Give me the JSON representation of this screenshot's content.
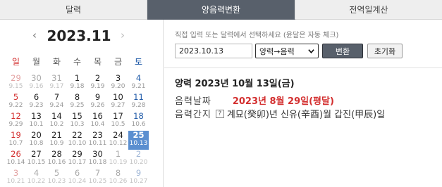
{
  "tabs": [
    {
      "label": "달력"
    },
    {
      "label": "양음력변환"
    },
    {
      "label": "전역일계산"
    }
  ],
  "calendar": {
    "title": "2023.11",
    "prev": "‹",
    "next": "›",
    "weekdays": [
      "일",
      "월",
      "화",
      "수",
      "목",
      "금",
      "토"
    ],
    "weeks": [
      [
        {
          "sol": "29",
          "lun": "9.15",
          "out": true
        },
        {
          "sol": "30",
          "lun": "9.16",
          "out": true
        },
        {
          "sol": "31",
          "lun": "9.17",
          "out": true
        },
        {
          "sol": "1",
          "lun": "9.18"
        },
        {
          "sol": "2",
          "lun": "9.19"
        },
        {
          "sol": "3",
          "lun": "9.20"
        },
        {
          "sol": "4",
          "lun": "9.21"
        }
      ],
      [
        {
          "sol": "5",
          "lun": "9.22"
        },
        {
          "sol": "6",
          "lun": "9.23"
        },
        {
          "sol": "7",
          "lun": "9.24"
        },
        {
          "sol": "8",
          "lun": "9.25"
        },
        {
          "sol": "9",
          "lun": "9.26"
        },
        {
          "sol": "10",
          "lun": "9.27"
        },
        {
          "sol": "11",
          "lun": "9.28"
        }
      ],
      [
        {
          "sol": "12",
          "lun": "9.29"
        },
        {
          "sol": "13",
          "lun": "10.1"
        },
        {
          "sol": "14",
          "lun": "10.2"
        },
        {
          "sol": "15",
          "lun": "10.3"
        },
        {
          "sol": "16",
          "lun": "10.4"
        },
        {
          "sol": "17",
          "lun": "10.5"
        },
        {
          "sol": "18",
          "lun": "10.6"
        }
      ],
      [
        {
          "sol": "19",
          "lun": "10.7"
        },
        {
          "sol": "20",
          "lun": "10.8"
        },
        {
          "sol": "21",
          "lun": "10.9"
        },
        {
          "sol": "22",
          "lun": "10.10"
        },
        {
          "sol": "23",
          "lun": "10.11"
        },
        {
          "sol": "24",
          "lun": "10.12"
        },
        {
          "sol": "25",
          "lun": "10.13",
          "selected": true
        }
      ],
      [
        {
          "sol": "26",
          "lun": "10.14"
        },
        {
          "sol": "27",
          "lun": "10.15"
        },
        {
          "sol": "28",
          "lun": "10.16"
        },
        {
          "sol": "29",
          "lun": "10.17"
        },
        {
          "sol": "30",
          "lun": "10.18"
        },
        {
          "sol": "1",
          "lun": "10.19",
          "out": true
        },
        {
          "sol": "2",
          "lun": "10.20",
          "out": true
        }
      ],
      [
        {
          "sol": "3",
          "lun": "10.21",
          "out": true
        },
        {
          "sol": "4",
          "lun": "10.22",
          "out": true
        },
        {
          "sol": "5",
          "lun": "10.23",
          "out": true
        },
        {
          "sol": "6",
          "lun": "10.24",
          "out": true
        },
        {
          "sol": "7",
          "lun": "10.25",
          "out": true
        },
        {
          "sol": "8",
          "lun": "10.26",
          "out": true
        },
        {
          "sol": "9",
          "lun": "10.27",
          "out": true
        }
      ]
    ]
  },
  "converter": {
    "hint": "직접 입력 또는 달력에서 선택하세요 (윤달은 자동 체크)",
    "date_value": "2023.10.13",
    "direction": "양력→음력",
    "convert_label": "변환",
    "reset_label": "초기화"
  },
  "result": {
    "title": "양력 2023년 10월 13일(금)",
    "lunar_label": "음력날짜",
    "lunar_value": "2023년 8월 29일(평달)",
    "ganji_label": "음력간지",
    "help_glyph": "?",
    "ganji_value": "계묘(癸卯)년 신유(辛酉)월 갑진(甲辰)일"
  },
  "colors": {
    "active_tab": "#58606b",
    "sunday": "#d32f2f",
    "saturday": "#1f5aa8",
    "selected_day": "#5b8fd0",
    "lunar_value": "#d32f2f"
  }
}
